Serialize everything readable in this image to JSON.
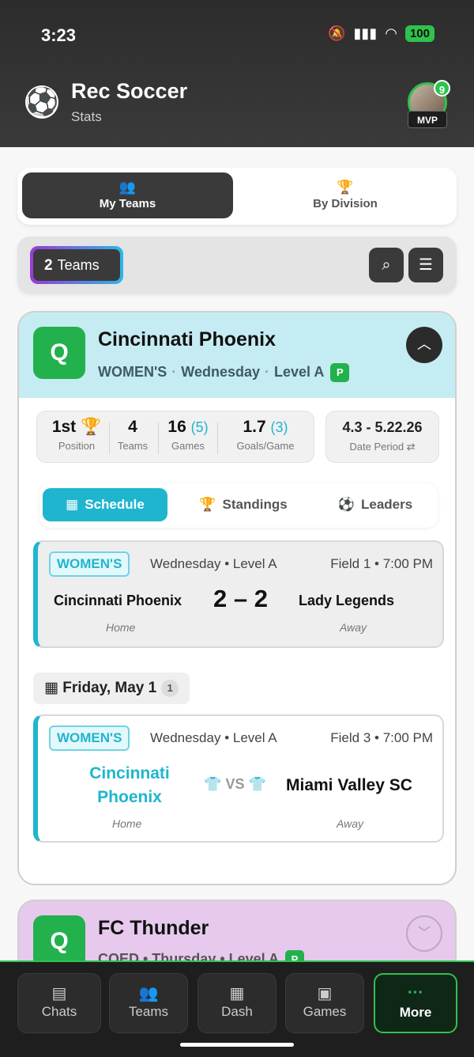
{
  "status": {
    "time": "3:23",
    "battery": "100"
  },
  "app": {
    "title": "Rec Soccer",
    "subtitle": "Stats",
    "avatar_badge": "9",
    "avatar_tag": "MVP"
  },
  "segments": [
    {
      "label": "My Teams"
    },
    {
      "label": "By Division"
    }
  ],
  "teams_bar": {
    "count": "2",
    "label": "Teams"
  },
  "team1": {
    "badge": "Q",
    "name": "Cincinnati Phoenix",
    "gender": "WOMEN'S",
    "day": "Wednesday",
    "level": "Level A",
    "level_badge": "P",
    "stats": {
      "position": "1st",
      "position_label": "Position",
      "teams": "4",
      "teams_label": "Teams",
      "games": "16",
      "games_sub": "(5)",
      "games_label": "Games",
      "gpg": "1.7",
      "gpg_sub": "(3)",
      "gpg_label": "Goals/Game"
    },
    "date_period": {
      "value": "4.3 - 5.22.26",
      "label": "Date Period"
    },
    "tabs": [
      {
        "label": "Schedule"
      },
      {
        "label": "Standings"
      },
      {
        "label": "Leaders"
      }
    ],
    "games": [
      {
        "division": "WOMEN'S",
        "meta": "Wednesday • Level A",
        "field": "Field 1 • 7:00 PM",
        "home": "Cincinnati Phoenix",
        "score": "2 – 2",
        "away": "Lady Legends",
        "home_label": "Home",
        "away_label": "Away"
      },
      {
        "division": "WOMEN'S",
        "meta": "Wednesday • Level A",
        "field": "Field 3 • 7:00 PM",
        "home": "Cincinnati Phoenix",
        "vs": "VS",
        "away": "Miami Valley SC",
        "home_label": "Home",
        "away_label": "Away"
      }
    ],
    "day_label": "Friday, May 1",
    "day_count": "1"
  },
  "team2": {
    "badge": "Q",
    "name": "FC Thunder",
    "meta": "COED • Thursday • Level A",
    "level_badge": "P"
  },
  "nav": [
    {
      "label": "Chats"
    },
    {
      "label": "Teams"
    },
    {
      "label": "Dash"
    },
    {
      "label": "Games"
    },
    {
      "label": "More"
    }
  ],
  "colors": {
    "accent": "#1fb5cf",
    "green": "#2fc24d",
    "dark": "#3a3a3a"
  }
}
